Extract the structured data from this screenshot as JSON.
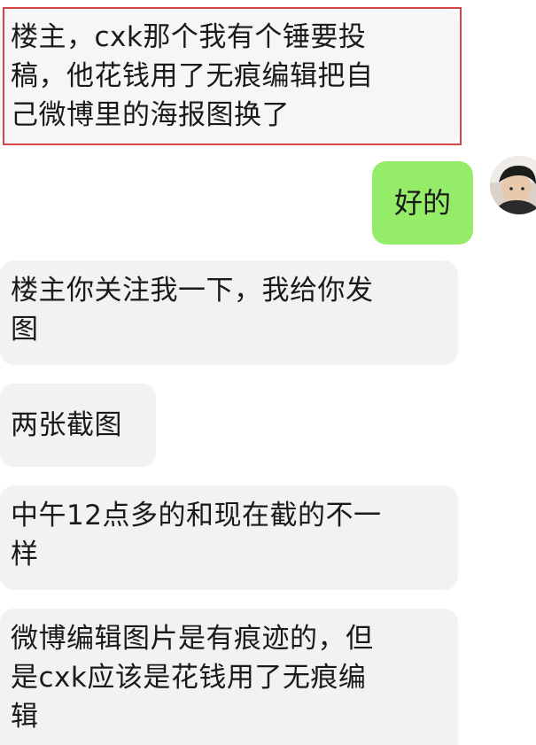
{
  "messages": {
    "m1": "楼主，cxk那个我有个锤要投\n稿，他花钱用了无痕编辑把自\n己微博里的海报图换了",
    "m2": "好的",
    "m3": "楼主你关注我一下，我给你发\n图",
    "m4": "两张截图",
    "m5": "中午12点多的和现在截的不一\n样",
    "m6": "微博编辑图片是有痕迹的，但\n是cxk应该是花钱用了无痕编\n辑"
  },
  "colors": {
    "incoming_bubble": "#f2f2f2",
    "outgoing_bubble": "#95ec69",
    "highlight_border": "#d64545"
  },
  "icons": {
    "avatar": "user-avatar-photo"
  }
}
